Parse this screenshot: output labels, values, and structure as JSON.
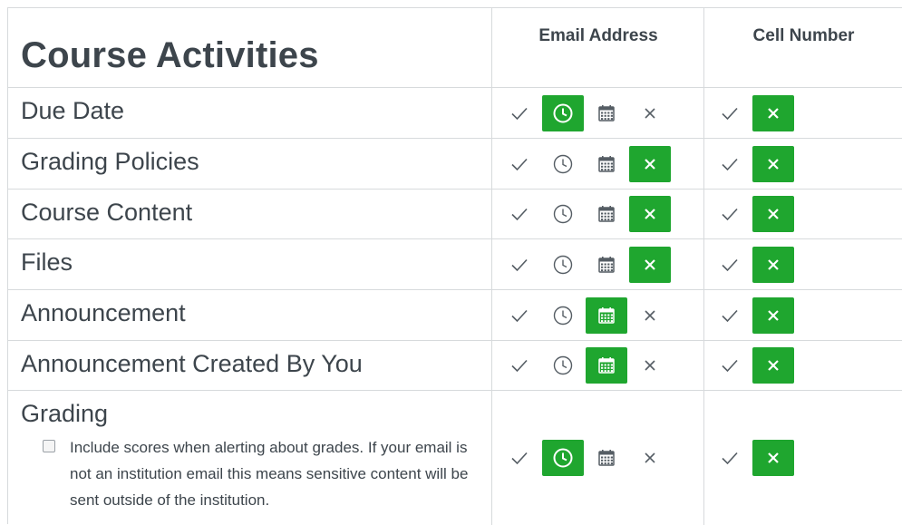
{
  "title": "Course Activities",
  "columns": [
    "Email Address",
    "Cell Number"
  ],
  "rows": [
    {
      "label": "Due Date",
      "email_selected": "clock",
      "cell_selected": "never"
    },
    {
      "label": "Grading Policies",
      "email_selected": "never",
      "cell_selected": "never"
    },
    {
      "label": "Course Content",
      "email_selected": "never",
      "cell_selected": "never"
    },
    {
      "label": "Files",
      "email_selected": "never",
      "cell_selected": "never"
    },
    {
      "label": "Announcement",
      "email_selected": "calendar",
      "cell_selected": "never"
    },
    {
      "label": "Announcement Created By You",
      "email_selected": "calendar",
      "cell_selected": "never"
    },
    {
      "label": "Grading",
      "email_selected": "clock",
      "cell_selected": "never"
    }
  ],
  "grading_note": "Include scores when alerting about grades. If your email is not an institution email this means sensitive content will be sent outside of the institution.",
  "grading_note_checked": false,
  "colors": {
    "selected": "#1fa62f",
    "icon": "#555d64",
    "border": "#d7dadc",
    "text": "#3d454c"
  },
  "icons": {
    "immediately": "check-icon",
    "daily": "clock-icon",
    "weekly": "calendar-icon",
    "never": "close-icon"
  }
}
